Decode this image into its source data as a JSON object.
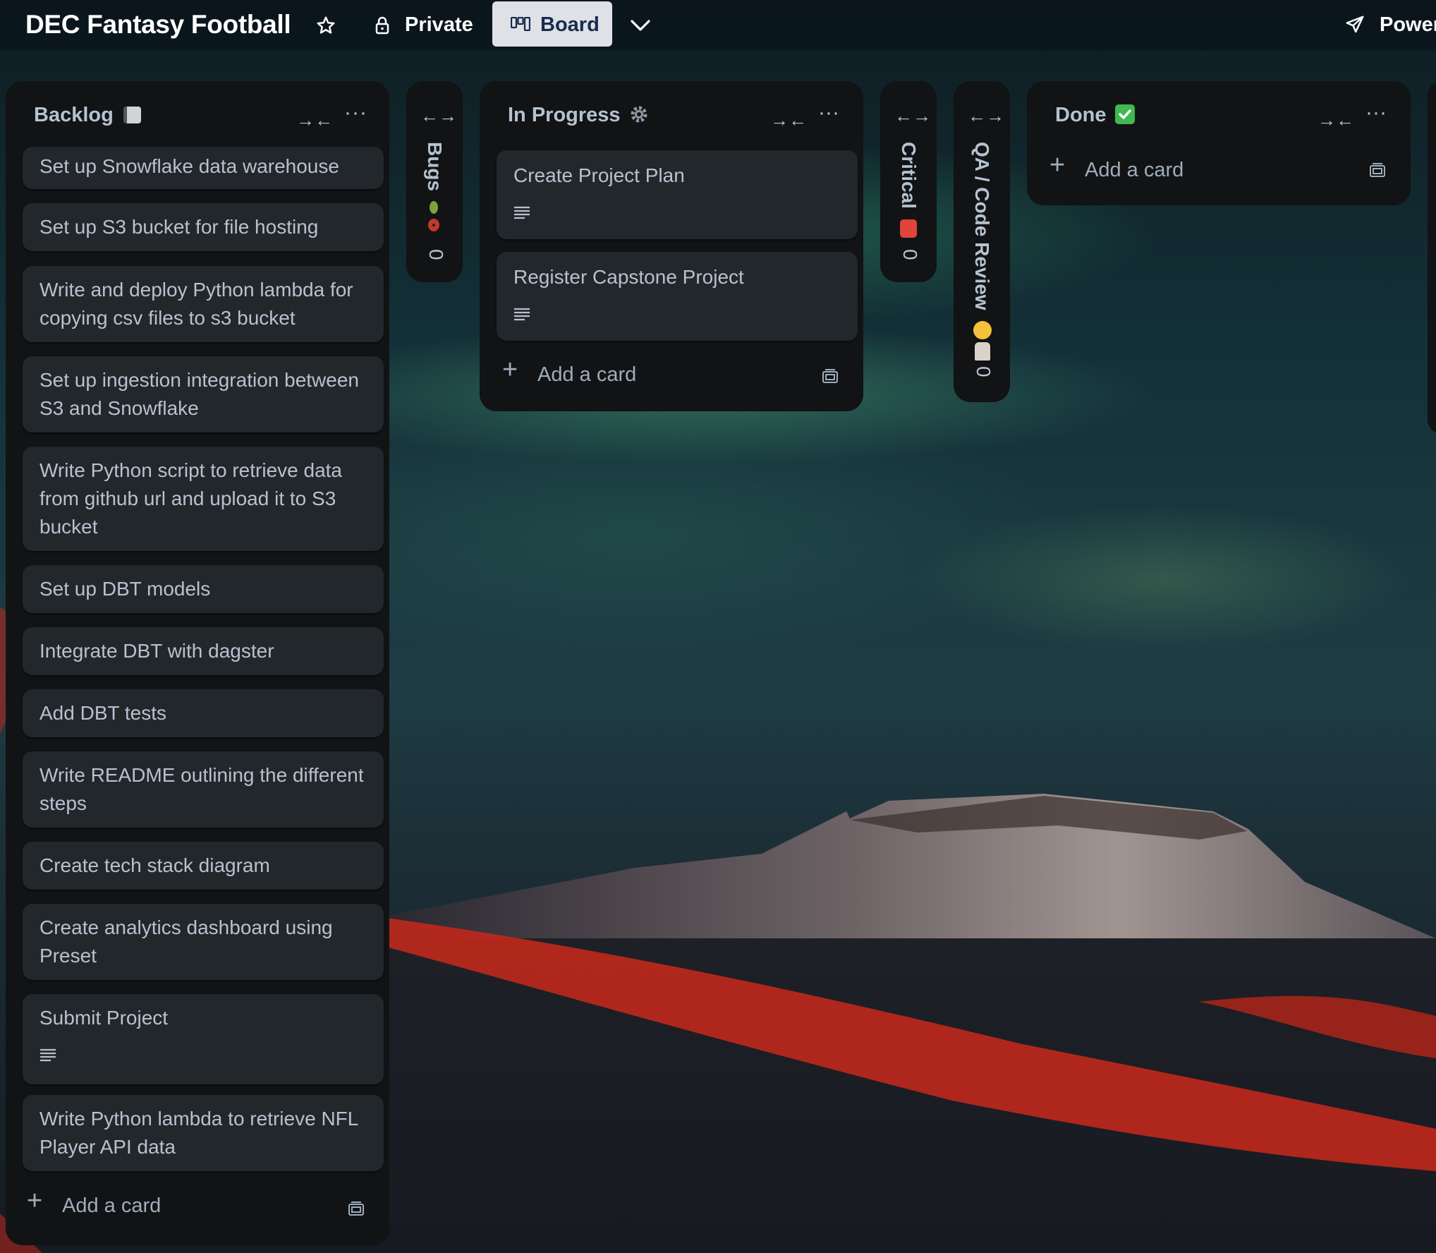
{
  "header": {
    "board_title": "DEC Fantasy Football",
    "visibility_label": "Private",
    "view_label": "Board",
    "power_ups_label": "Power"
  },
  "lists": {
    "backlog": {
      "title": "Backlog",
      "cards": [
        "Set up Snowflake data warehouse",
        "Set up S3 bucket for file hosting",
        "Write and deploy Python lambda for copying csv files to s3 bucket",
        "Set up ingestion integration between S3 and Snowflake",
        "Write Python script to retrieve data from github url and upload it to S3 bucket",
        "Set up DBT models",
        "Integrate DBT with dagster",
        "Add DBT tests",
        "Write README outlining the different steps",
        "Create tech stack diagram",
        "Create analytics dashboard using Preset",
        "Submit Project",
        "Write Python lambda to retrieve NFL Player API data"
      ],
      "add_card_label": "Add a card"
    },
    "bugs": {
      "title": "Bugs",
      "count": "0"
    },
    "in_progress": {
      "title": "In Progress",
      "cards": [
        "Create Project Plan",
        "Register Capstone Project"
      ],
      "add_card_label": "Add a card"
    },
    "critical": {
      "title": "Critical",
      "count": "0"
    },
    "qa": {
      "title": "QA / Code Review",
      "count": "0"
    },
    "done": {
      "title": "Done",
      "add_card_label": "Add a card"
    }
  },
  "icons": {
    "star": "star-icon",
    "lock": "lock-icon",
    "board": "board-icon",
    "chevron": "chevron-down-icon",
    "rocket": "rocket-icon",
    "collapse": "collapse-icon",
    "expand": "expand-icon",
    "more": "more-icon",
    "template": "template-icon",
    "description": "description-icon"
  },
  "colors": {
    "list_bg": "#111315",
    "card_bg": "#22272b",
    "text": "#b6c2cf",
    "board_button_bg": "#dfe1e6"
  }
}
